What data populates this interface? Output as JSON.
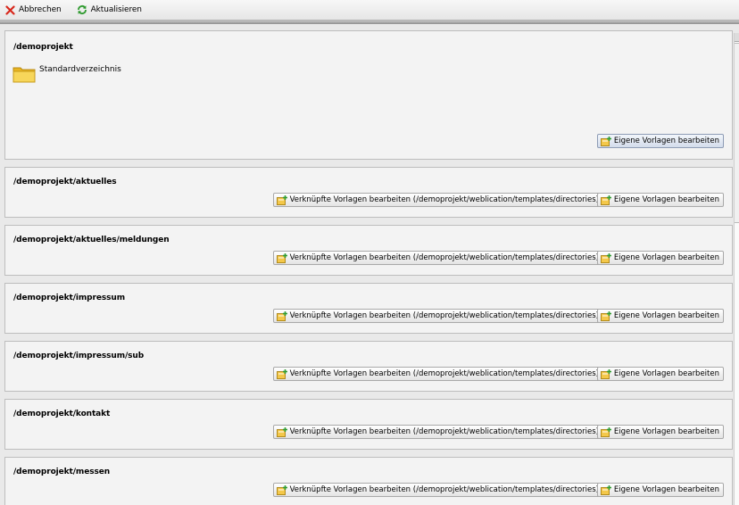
{
  "toolbar": {
    "cancel_label": "Abbrechen",
    "refresh_label": "Aktualisieren"
  },
  "root_panel": {
    "path": "/demoprojekt",
    "folder_label": "Standardverzeichnis",
    "own_templates_label": "Eigene Vorlagen bearbeiten"
  },
  "panels": [
    {
      "path": "/demoprojekt/aktuelles",
      "linked_label": "Verknüpfte Vorlagen bearbeiten (/demoprojekt/weblication/templates/directories)",
      "own_label": "Eigene Vorlagen bearbeiten"
    },
    {
      "path": "/demoprojekt/aktuelles/meldungen",
      "linked_label": "Verknüpfte Vorlagen bearbeiten (/demoprojekt/weblication/templates/directories)",
      "own_label": "Eigene Vorlagen bearbeiten"
    },
    {
      "path": "/demoprojekt/impressum",
      "linked_label": "Verknüpfte Vorlagen bearbeiten (/demoprojekt/weblication/templates/directories)",
      "own_label": "Eigene Vorlagen bearbeiten"
    },
    {
      "path": "/demoprojekt/impressum/sub",
      "linked_label": "Verknüpfte Vorlagen bearbeiten (/demoprojekt/weblication/templates/directories)",
      "own_label": "Eigene Vorlagen bearbeiten"
    },
    {
      "path": "/demoprojekt/kontakt",
      "linked_label": "Verknüpfte Vorlagen bearbeiten (/demoprojekt/weblication/templates/directories)",
      "own_label": "Eigene Vorlagen bearbeiten"
    },
    {
      "path": "/demoprojekt/messen",
      "linked_label": "Verknüpfte Vorlagen bearbeiten (/demoprojekt/weblication/templates/directories)",
      "own_label": "Eigene Vorlagen bearbeiten"
    }
  ],
  "icons": {
    "cancel": "close-icon",
    "refresh": "refresh-icon",
    "folder": "folder-icon",
    "template": "template-edit-icon"
  },
  "colors": {
    "cancel_red": "#d8281c",
    "refresh_green": "#2f9a2f",
    "folder_yellow": "#f5cd3c"
  }
}
